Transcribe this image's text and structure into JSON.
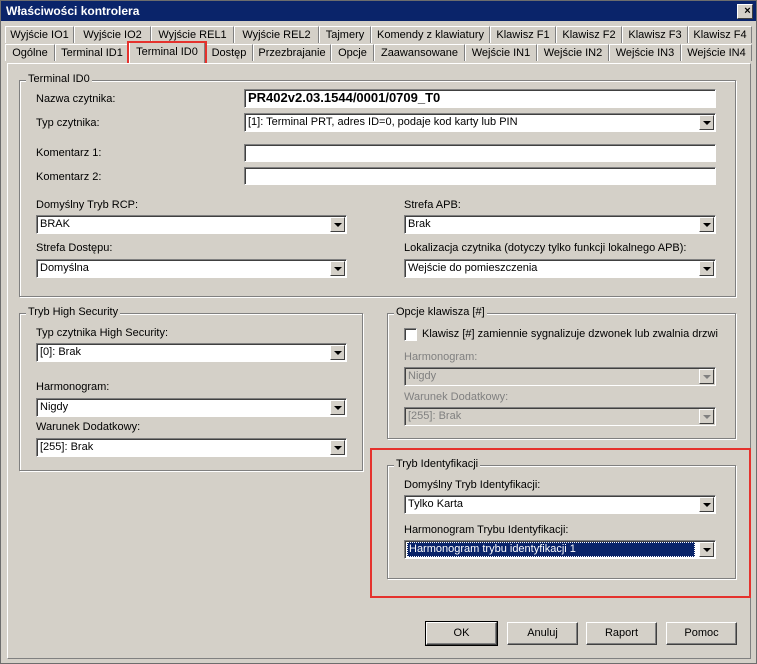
{
  "window": {
    "title": "Właściwości kontrolera",
    "close_symbol": "×"
  },
  "tabs_row1": [
    "Wyjście IO1",
    "Wyjście IO2",
    "Wyjście REL1",
    "Wyjście REL2",
    "Tajmery",
    "Komendy z klawiatury",
    "Klawisz F1",
    "Klawisz F2",
    "Klawisz F3",
    "Klawisz F4"
  ],
  "tabs_row2": [
    "Ogólne",
    "Terminal ID1",
    "Terminal ID0",
    "Dostęp",
    "Przezbrajanie",
    "Opcje",
    "Zaawansowane",
    "Wejście IN1",
    "Wejście IN2",
    "Wejście IN3",
    "Wejście IN4"
  ],
  "active_tab": "Terminal ID0",
  "terminal": {
    "legend": "Terminal ID0",
    "reader_name_label": "Nazwa czytnika:",
    "reader_name_value": "PR402v2.03.1544/0001/0709_T0",
    "reader_type_label": "Typ czytnika:",
    "reader_type_value": "[1]: Terminal PRT, adres ID=0, podaje kod karty lub PIN",
    "comment1_label": "Komentarz 1:",
    "comment1_value": "",
    "comment2_label": "Komentarz 2:",
    "comment2_value": "",
    "rcp_label": "Domyślny Tryb RCP:",
    "rcp_value": "BRAK",
    "apb_label": "Strefa APB:",
    "apb_value": "Brak",
    "access_zone_label": "Strefa Dostępu:",
    "access_zone_value": "Domyślna",
    "location_label": "Lokalizacja czytnika (dotyczy tylko funkcji lokalnego APB):",
    "location_value": "Wejście do pomieszczenia"
  },
  "high_security": {
    "legend": "Tryb High Security",
    "type_label": "Typ czytnika High Security:",
    "type_value": "[0]: Brak",
    "schedule_label": "Harmonogram:",
    "schedule_value": "Nigdy",
    "condition_label": "Warunek Dodatkowy:",
    "condition_value": "[255]: Brak"
  },
  "key_options": {
    "legend": "Opcje klawisza [#]",
    "checkbox_label": "Klawisz [#] zamiennie sygnalizuje dzwonek lub zwalnia drzwi",
    "schedule_label": "Harmonogram:",
    "schedule_value": "Nigdy",
    "condition_label": "Warunek Dodatkowy:",
    "condition_value": "[255]: Brak"
  },
  "identification": {
    "legend": "Tryb Identyfikacji",
    "default_label": "Domyślny Tryb Identyfikacji:",
    "default_value": "Tylko Karta",
    "schedule_label": "Harmonogram Trybu Identyfikacji:",
    "schedule_value": "Harmonogram trybu identyfikacji 1"
  },
  "buttons": {
    "ok": "OK",
    "cancel": "Anuluj",
    "report": "Raport",
    "help": "Pomoc"
  },
  "colors": {
    "titlebar": "#0a246a",
    "highlight": "#e5322d",
    "face": "#d4d0c8"
  }
}
